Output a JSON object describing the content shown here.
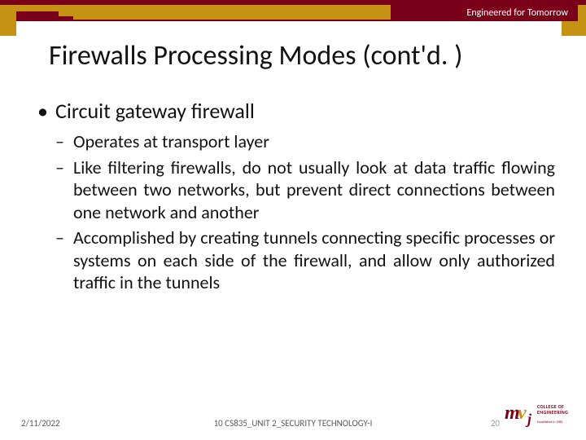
{
  "header": {
    "tagline": "Engineered for Tomorrow"
  },
  "title": "Firewalls Processing Modes (cont'd. )",
  "body": {
    "bullet1": "Circuit gateway firewall",
    "sub1": "Operates at transport layer",
    "sub2": "Like filtering firewalls, do not usually look at data traffic flowing between two networks, but prevent direct connections between one network and another",
    "sub3": "Accomplished by creating tunnels connecting specific processes or systems on each side of the firewall, and allow only authorized traffic in the tunnels"
  },
  "footer": {
    "date": "2/11/2022",
    "center": "10 CS835_UNIT 2_SECURITY TECHNOLOGY-I",
    "page": "20"
  },
  "logo": {
    "line1": "COLLEGE OF",
    "line2": "ENGINEERING",
    "sub": "Established in 1982"
  }
}
